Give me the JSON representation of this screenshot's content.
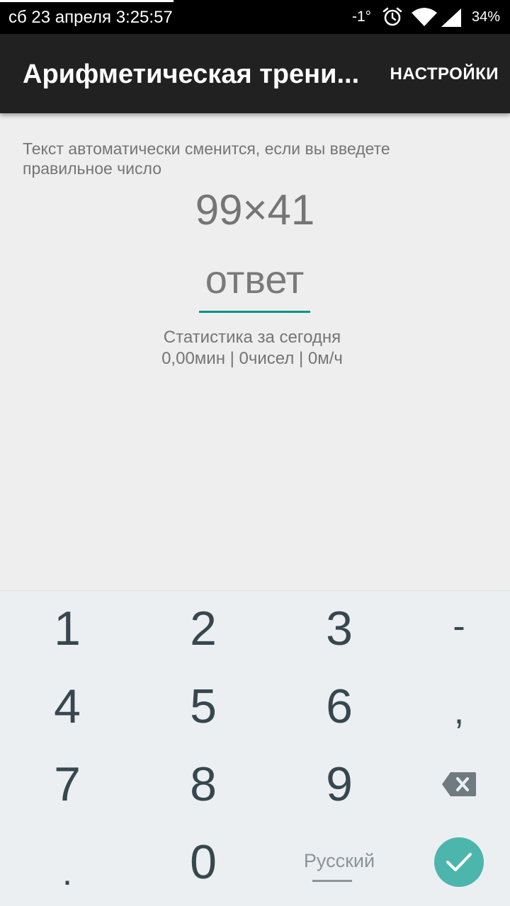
{
  "status_bar": {
    "datetime": "сб 23 апреля 3:25:57",
    "temperature": "-1°",
    "battery": "34%",
    "icons": [
      "alarm-icon",
      "wifi-icon",
      "signal-icon"
    ]
  },
  "app_bar": {
    "title": "Арифметическая трени...",
    "settings_label": "НАСТРОЙКИ"
  },
  "main": {
    "hint": "Текст автоматически сменится, если вы введете правильное число",
    "problem": "99×41",
    "answer_placeholder": "ответ",
    "stats_title": "Статистика за сегодня",
    "stats_values": "0,00мин | 0чисел | 0м/ч"
  },
  "keyboard": {
    "keys": {
      "k1": "1",
      "k2": "2",
      "k3": "3",
      "minus": "-",
      "k4": "4",
      "k5": "5",
      "k6": "6",
      "comma": ",",
      "k7": "7",
      "k8": "8",
      "k9": "9",
      "period": ".",
      "k0": "0"
    },
    "language": "Русский",
    "icons": [
      "backspace-icon",
      "checkmark-icon"
    ]
  },
  "colors": {
    "accent": "#009688",
    "enter_button": "#4db6ac",
    "app_bar": "#212121",
    "key_text": "#37474f"
  }
}
